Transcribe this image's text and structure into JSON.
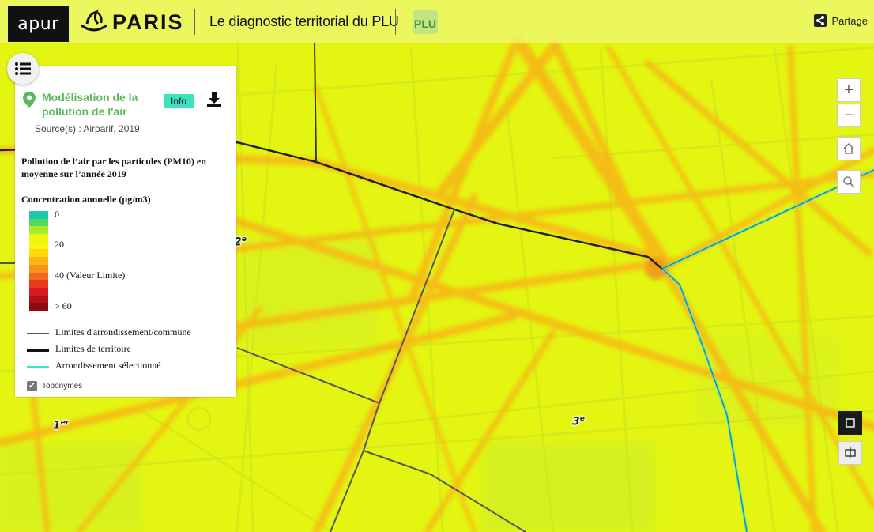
{
  "header": {
    "apur_logo": "apur",
    "paris_logo": "PARIS",
    "app_title": "Le diagnostic territorial du PLU",
    "plu_logo": "PLU",
    "share_label": "Partage"
  },
  "layer": {
    "title": "Modélisation de la pollution de l'air",
    "info_label": "Info",
    "source": "Source(s) : Airparif, 2019"
  },
  "legend": {
    "title": "Pollution de l’air par les particules (PM10) en moyenne sur l’année 2019",
    "concentration_title": "Concentration annuelle (µg/m3)",
    "ramp_labels": [
      "0",
      "20",
      "40 (Valeur Limite)",
      "> 60"
    ],
    "ramp_colors": [
      "#1ac9ac",
      "#55d85a",
      "#a9ec2f",
      "#e8f70f",
      "#fcf20b",
      "#fed90e",
      "#fbb611",
      "#f7931a",
      "#f06a1e",
      "#e8391f",
      "#d61c1e",
      "#b41116",
      "#8c0a12"
    ],
    "lines": [
      {
        "label": "Limites d'arrondissement/commune",
        "color": "#555555"
      },
      {
        "label": "Limites de territoire",
        "color": "#111111"
      },
      {
        "label": "Arrondissement sélectionné",
        "color": "#3ee2d4"
      }
    ],
    "toponymes_label": "Toponymes"
  },
  "map": {
    "arrondissement_labels": [
      {
        "num": "1",
        "sup": "er"
      },
      {
        "num": "2",
        "sup": "e"
      },
      {
        "num": "3",
        "sup": "e"
      }
    ]
  },
  "controls": {
    "zoom_in": "+",
    "zoom_out": "−"
  }
}
